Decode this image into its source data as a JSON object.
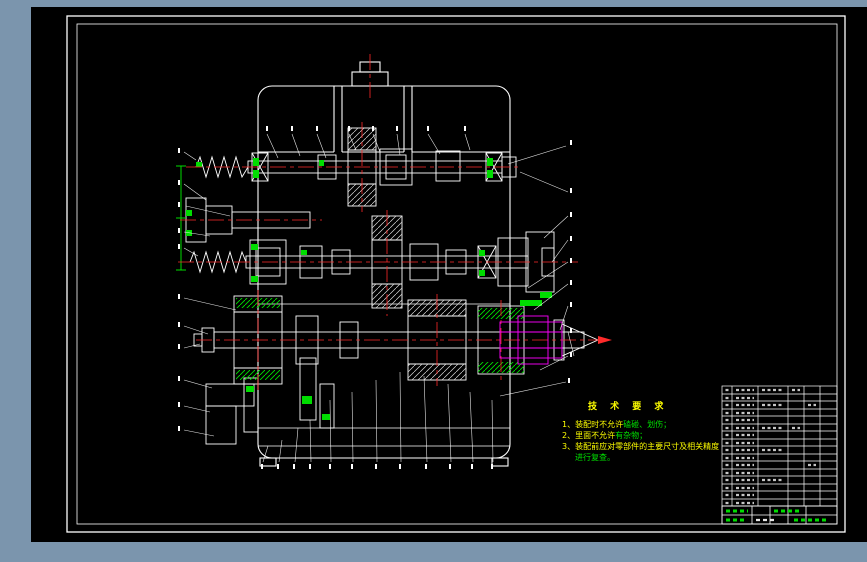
{
  "palette": {
    "window_bg": "#7b95ad",
    "sheet_bg": "#000000",
    "line_white": "#ffffff",
    "centerline_red": "#ff2a2a",
    "highlight_green": "#00dd00",
    "accent_magenta": "#ff00ff",
    "note_yellow": "#ffff00",
    "note_green": "#00e000"
  },
  "drawing": {
    "subject": "gearbox-assembly-section-view"
  },
  "notes": {
    "heading": "技 术 要 求",
    "lines": [
      {
        "segs": [
          {
            "t": "1、装配时不允许",
            "c": "note_yellow"
          },
          {
            "t": "磕碰、划伤；",
            "c": "note_green"
          }
        ]
      },
      {
        "segs": [
          {
            "t": "2、里面不允许",
            "c": "note_yellow"
          },
          {
            "t": "有杂物；",
            "c": "note_green"
          }
        ]
      },
      {
        "segs": [
          {
            "t": "3、装配前应对零部件的主要尺寸及相关精度",
            "c": "note_yellow"
          }
        ]
      },
      {
        "indent": true,
        "segs": [
          {
            "t": "进行复查。",
            "c": "note_green"
          }
        ]
      }
    ]
  }
}
